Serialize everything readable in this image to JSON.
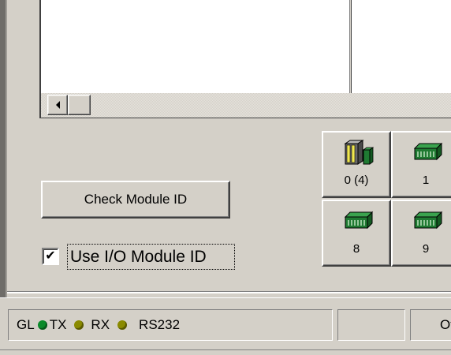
{
  "list_panel": {
    "scroll_left_icon": "triangle-left-icon"
  },
  "buttons": {
    "check_module_id": "Check Module ID"
  },
  "options": {
    "use_io_module_id_label": "Use I/O Module ID",
    "use_io_module_id_checked": true,
    "checkmark": "✔"
  },
  "modules": [
    {
      "label": "0 (4)",
      "icon": "cpu-module-icon"
    },
    {
      "label": "1",
      "icon": "io-module-icon"
    },
    {
      "label": "8",
      "icon": "io-module-icon"
    },
    {
      "label": "9",
      "icon": "io-module-icon"
    }
  ],
  "status_bar": {
    "gl_label": "GL",
    "tx_label": "TX",
    "rx_label": "RX",
    "port": "RS232",
    "state_text": "Of",
    "colors": {
      "gl_led": "#0a8a2a",
      "tx_led": "#8a8a00",
      "rx_led": "#8a8a00"
    }
  },
  "colors": {
    "window_bg": "#d4d0c8",
    "module_green": "#1f7a32",
    "module_yellow": "#f0e850"
  }
}
